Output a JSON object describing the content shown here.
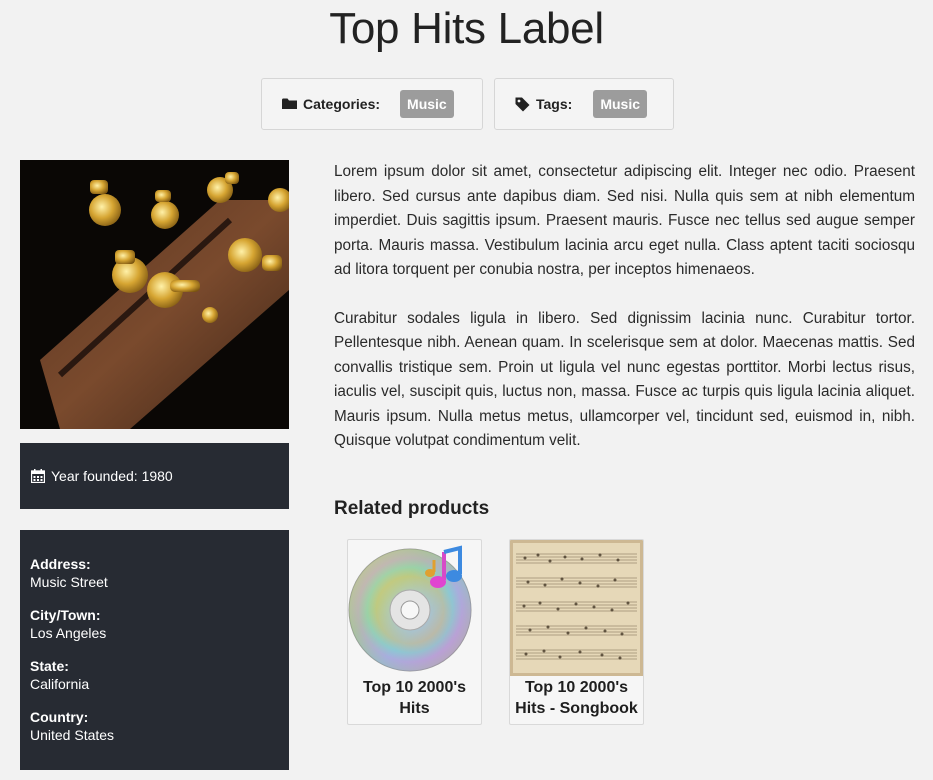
{
  "page": {
    "title": "Top Hits Label"
  },
  "categories": {
    "label": "Categories:",
    "value": "Music"
  },
  "tags": {
    "label": "Tags:",
    "value": "Music"
  },
  "sidebar": {
    "year_founded": "Year founded: 1980",
    "address_label": "Address:",
    "address": "Music Street",
    "city_label": "City/Town:",
    "city": "Los Angeles",
    "state_label": "State:",
    "state": "California",
    "country_label": "Country:",
    "country": "United States"
  },
  "description": {
    "p1": "Lorem ipsum dolor sit amet, consectetur adipiscing elit. Integer nec odio. Praesent libero. Sed cursus ante dapibus diam. Sed nisi. Nulla quis sem at nibh elementum imperdiet. Duis sagittis ipsum. Praesent mauris. Fusce nec tellus sed augue semper porta. Mauris massa. Vestibulum lacinia arcu eget nulla. Class aptent taciti sociosqu ad litora torquent per conubia nostra, per inceptos himenaeos.",
    "p2": "Curabitur sodales ligula in libero. Sed dignissim lacinia nunc. Curabitur tortor. Pellentesque nibh. Aenean quam. In scelerisque sem at dolor. Maecenas mattis. Sed convallis tristique sem. Proin ut ligula vel nunc egestas porttitor. Morbi lectus risus, iaculis vel, suscipit quis, luctus non, massa. Fusce ac turpis quis ligula lacinia aliquet. Mauris ipsum. Nulla metus metus, ullamcorper vel, tincidunt sed, euismod in, nibh. Quisque volutpat condimentum velit."
  },
  "related": {
    "title": "Related products",
    "items": [
      {
        "name": "Top 10 2000's Hits",
        "icon": "music-cd-icon"
      },
      {
        "name": "Top 10 2000's Hits - Songbook",
        "icon": "sheet-music-icon"
      }
    ]
  },
  "icons": {
    "categories": "folder-icon",
    "tags": "tag-icon",
    "year": "calendar-icon"
  }
}
